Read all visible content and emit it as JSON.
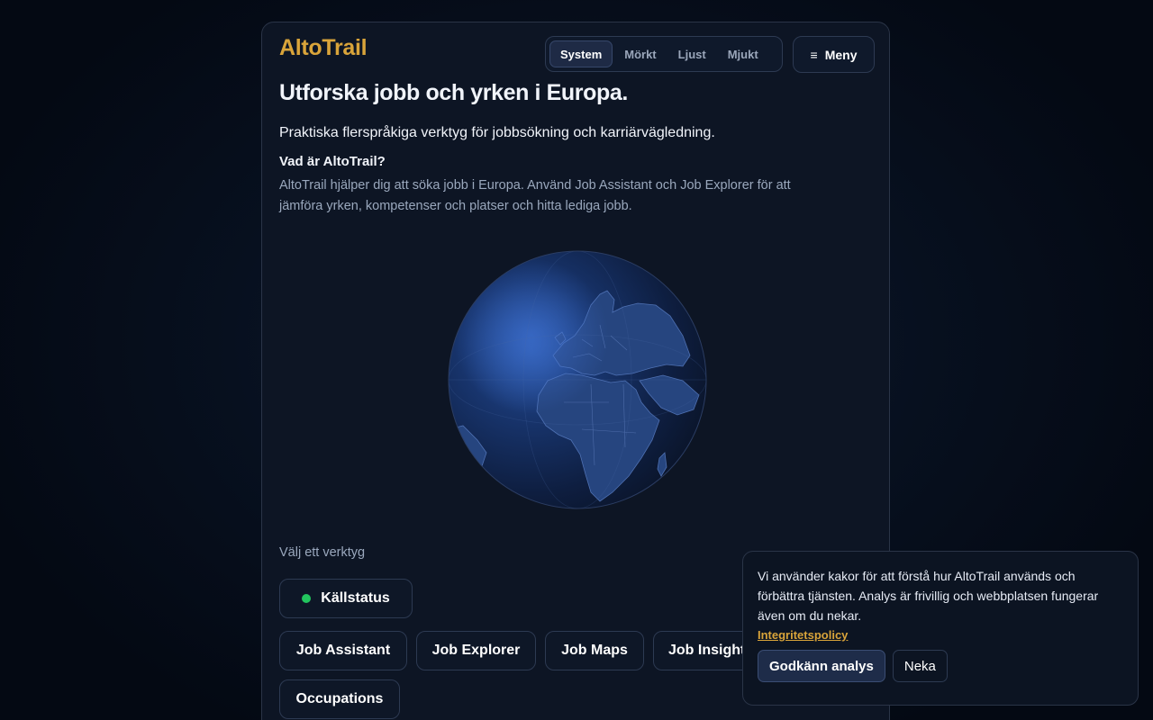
{
  "brand": "AltoTrail",
  "theme": {
    "options": [
      "System",
      "Mörkt",
      "Ljust",
      "Mjukt"
    ],
    "selected": "System"
  },
  "menu": {
    "icon": "hamburger-icon",
    "label": "Meny"
  },
  "hero": {
    "title": "Utforska jobb och yrken i Europa.",
    "lead": "Praktiska flerspråkiga verktyg för jobbsökning och karriärvägledning.",
    "what_title": "Vad är AltoTrail?",
    "what_text": "AltoTrail hjälper dig att söka jobb i Europa. Använd Job Assistant och Job Explorer för att jämföra yrken, kompetenser och platser och hitta lediga jobb."
  },
  "globe": {
    "icon": "globe-europe-illustration"
  },
  "tools": {
    "label": "Välj ett verktyg",
    "status": {
      "label": "Källstatus",
      "dot_color": "#22c55e"
    },
    "items": [
      "Job Assistant",
      "Job Explorer",
      "Job Maps",
      "Job Insights",
      "Occupations"
    ]
  },
  "cookie": {
    "text": "Vi använder kakor för att förstå hur AltoTrail används och förbättra tjänsten. Analys är frivillig och webbplatsen fungerar även om du nekar.",
    "policy_link": "Integritetspolicy",
    "accept": "Godkänn analys",
    "decline": "Neka"
  },
  "colors": {
    "accent": "#d9a43a",
    "background": "#07101f",
    "card": "#0d1524",
    "status_ok": "#22c55e"
  }
}
